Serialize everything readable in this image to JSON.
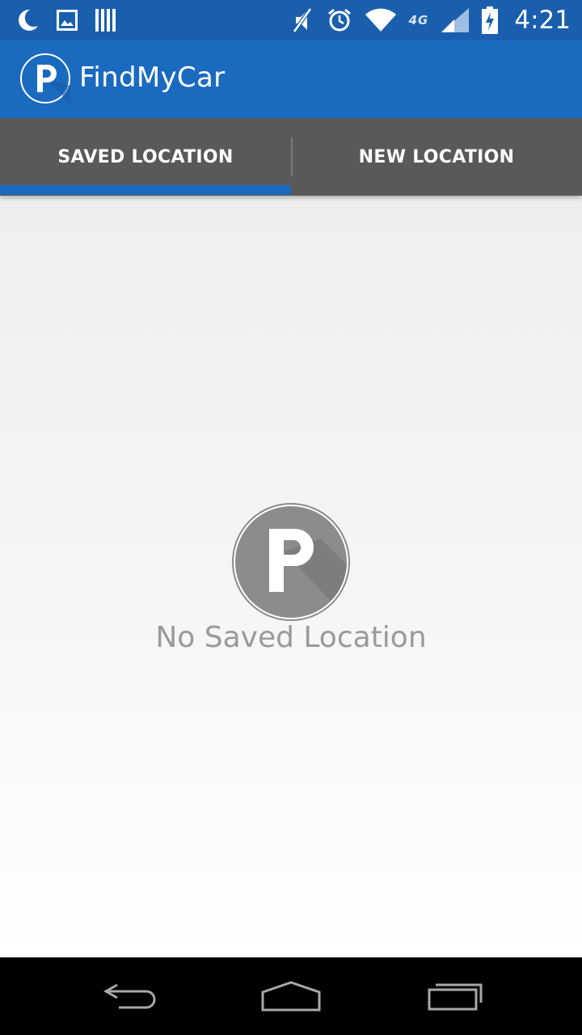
{
  "status_bar": {
    "time": "4:21",
    "network_label": "4G",
    "left_icons": [
      "moon-icon",
      "image-icon",
      "barcode-icon"
    ],
    "right_icons": [
      "mute-icon",
      "alarm-icon",
      "wifi-icon",
      "lte-icon",
      "signal-icon",
      "battery-charging-icon"
    ]
  },
  "app_bar": {
    "title": "FindMyCar",
    "logo_letter": "P",
    "color": "#1a6ac0"
  },
  "tabs": [
    {
      "label": "SAVED LOCATION",
      "selected": true
    },
    {
      "label": "NEW LOCATION",
      "selected": false
    }
  ],
  "content": {
    "empty_icon_letter": "P",
    "empty_message": "No Saved Location"
  },
  "nav_bar": {
    "buttons": [
      "back-icon",
      "home-icon",
      "recents-icon"
    ]
  },
  "colors": {
    "status_bar": "#1a5fae",
    "app_bar": "#1a6ac0",
    "tab_bar": "#595959",
    "indicator": "#1a6ac0",
    "empty_icon": "#8c8c8c"
  }
}
